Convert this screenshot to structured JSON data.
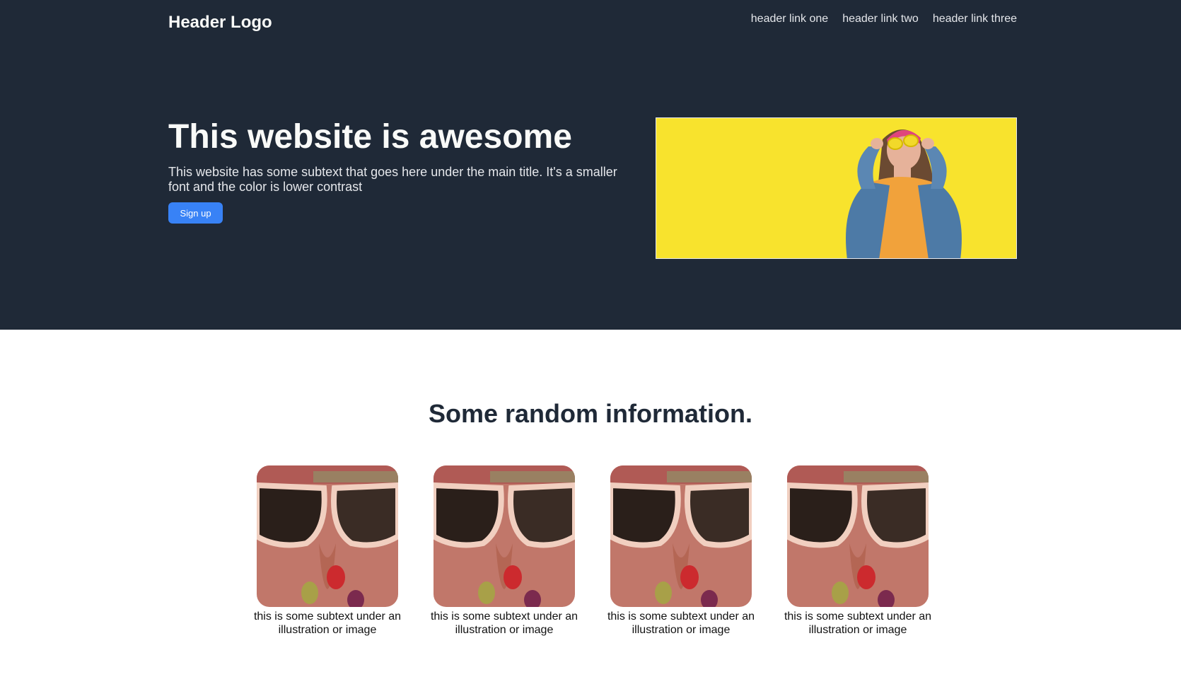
{
  "header": {
    "logo": "Header Logo",
    "links": [
      "header link one",
      "header link two",
      "header link three"
    ]
  },
  "hero": {
    "title": "This website is awesome",
    "subtext": "This website has some subtext that goes here under the main title. It's a smaller font and the color is lower contrast",
    "signup_label": "Sign up"
  },
  "info": {
    "title": "Some random information.",
    "cards": [
      {
        "caption": "this is some subtext under an illustration or image"
      },
      {
        "caption": "this is some subtext under an illustration or image"
      },
      {
        "caption": "this is some subtext under an illustration or image"
      },
      {
        "caption": "this is some subtext under an illustration or image"
      }
    ]
  },
  "colors": {
    "hero_bg": "#1f2937",
    "accent": "#3882f6",
    "heading_text": "#f9faf8",
    "body_text": "#e5e7eb"
  }
}
